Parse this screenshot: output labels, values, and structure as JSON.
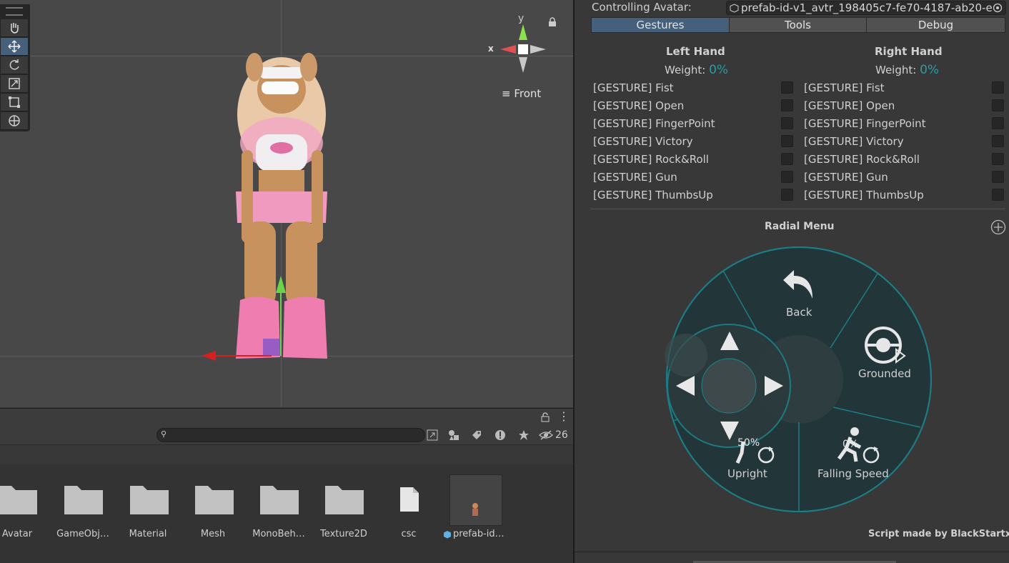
{
  "scene": {
    "gizmo_axis_y": "y",
    "gizmo_axis_x": "x",
    "view_label": "Front",
    "tools": [
      "hand-icon",
      "move-icon",
      "rotate-icon",
      "scale-icon",
      "rect-icon",
      "transform-icon"
    ]
  },
  "inspector": {
    "controlling_avatar_label": "Controlling Avatar:",
    "controlling_avatar_value": "prefab-id-v1_avtr_198405c7-fe70-4187-ab20-e",
    "tabs": [
      "Gestures",
      "Tools",
      "Debug"
    ],
    "active_tab": "Gestures",
    "left_hand": {
      "title": "Left Hand",
      "weight_label": "Weight:",
      "weight_value": "0%"
    },
    "right_hand": {
      "title": "Right Hand",
      "weight_label": "Weight:",
      "weight_value": "0%"
    },
    "gestures": [
      "[GESTURE] Fist",
      "[GESTURE] Open",
      "[GESTURE] FingerPoint",
      "[GESTURE] Victory",
      "[GESTURE] Rock&Roll",
      "[GESTURE] Gun",
      "[GESTURE] ThumbsUp"
    ],
    "radial_menu_title": "Radial Menu",
    "radial_items": {
      "back": "Back",
      "grounded": "Grounded",
      "upright": "Upright",
      "upright_value": "50%",
      "falling_speed": "Falling Speed",
      "falling_speed_value": "0%"
    },
    "credit": "Script made by BlackStartx",
    "accent_color": "#46607c",
    "radial_color": "#1d7d86"
  },
  "project": {
    "search_placeholder": "",
    "hidden_count": "26",
    "assets": [
      "Avatar",
      "GameObj…",
      "Material",
      "Mesh",
      "MonoBeh…",
      "Texture2D",
      "csc",
      "prefab-id…"
    ]
  }
}
